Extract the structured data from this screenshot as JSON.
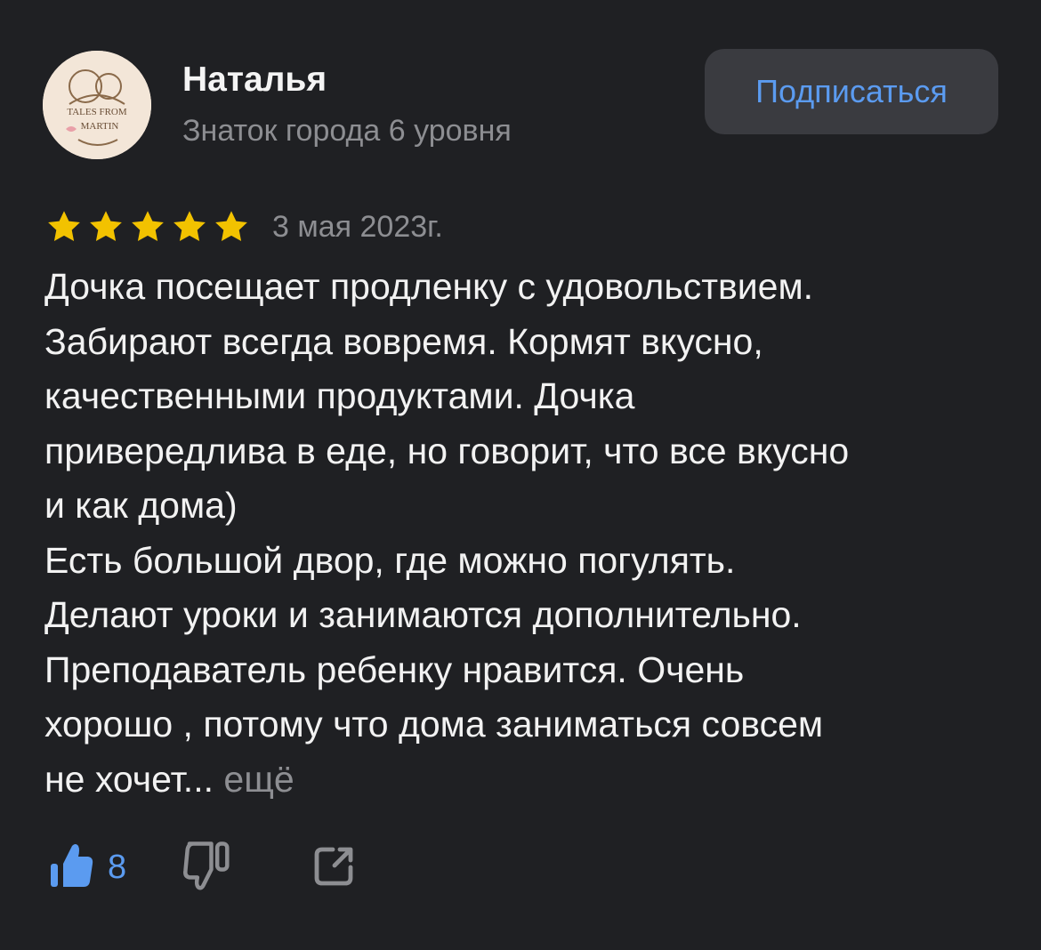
{
  "author": {
    "name": "Наталья",
    "level": "Знаток города 6 уровня",
    "avatar_text": [
      "TALES FROM",
      "MARTIN"
    ]
  },
  "subscribe": {
    "label": "Подписаться"
  },
  "review": {
    "rating": 5,
    "max_rating": 5,
    "date": "3 мая 2023г.",
    "text": "Дочка посещает продленку с удовольствием.\nЗабирают всегда вовремя. Кормят вкусно,\nкачественными продуктами. Дочка\nпривередлива в еде, но говорит, что все вкусно\nи как дома)\nЕсть большой двор, где можно погулять.\nДелают уроки и занимаются дополнительно.\nПреподаватель ребенку нравится. Очень\nхорошо , потому что дома заниматься совсем\nне хочет... ",
    "more_label": "ещё"
  },
  "actions": {
    "like_count": "8",
    "icons": [
      "thumbs-up-icon",
      "thumbs-down-icon",
      "share-icon"
    ]
  },
  "colors": {
    "background": "#1f2023",
    "accent": "#5b9bf0",
    "star": "#f2c200",
    "secondary_text": "#8d8e92",
    "button_bg": "#3a3b40"
  }
}
